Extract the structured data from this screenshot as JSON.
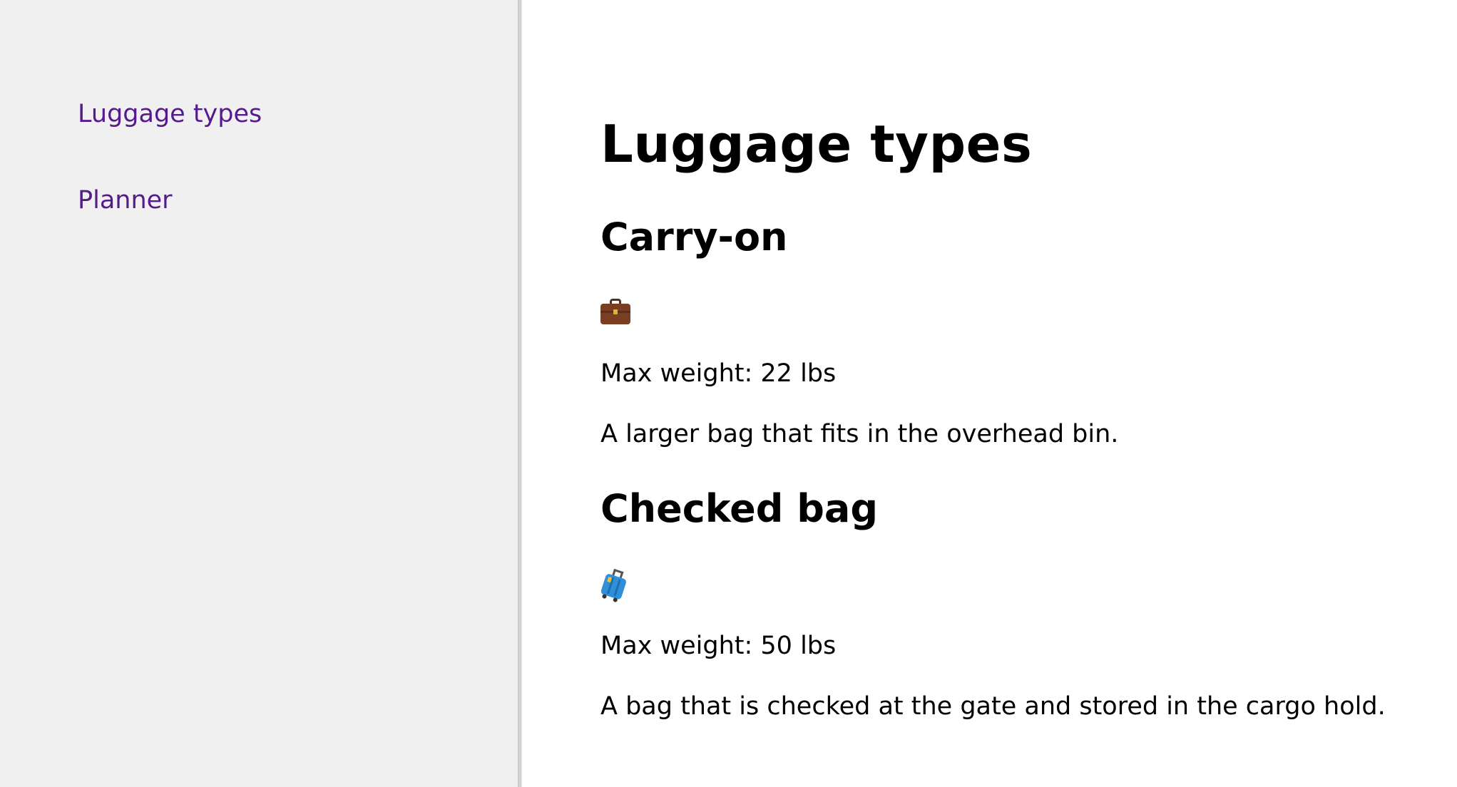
{
  "sidebar": {
    "links": [
      {
        "label": "Luggage types"
      },
      {
        "label": "Planner"
      }
    ]
  },
  "main": {
    "title": "Luggage types",
    "sections": [
      {
        "title": "Carry-on",
        "icon": "briefcase-icon",
        "weight": "Max weight: 22 lbs",
        "description": "A larger bag that fits in the overhead bin."
      },
      {
        "title": "Checked bag",
        "icon": "luggage-icon",
        "weight": "Max weight: 50 lbs",
        "description": "A bag that is checked at the gate and stored in the cargo hold."
      }
    ]
  },
  "colors": {
    "sidebar_background": "#f0f0f0",
    "link": "#551a8b",
    "divider": "#d3d3d3"
  }
}
